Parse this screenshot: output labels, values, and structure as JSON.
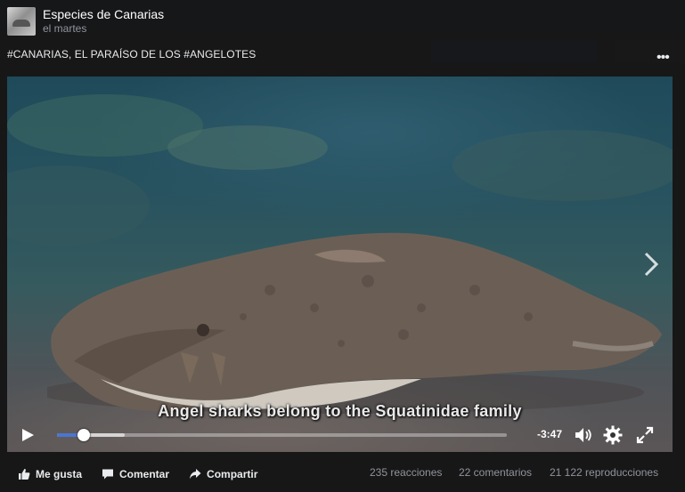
{
  "page": {
    "name": "Especies de Canarias",
    "time": "el martes"
  },
  "post": {
    "text": "#CANARIAS, EL PARAÍSO DE LOS #ANGELOTES"
  },
  "video": {
    "subtitle": "Angel sharks belong to the Squatinidae family",
    "remaining_time": "-3:47",
    "progress_fraction": 0.06,
    "buffered_fraction": 0.15
  },
  "actions": {
    "like": "Me gusta",
    "comment": "Comentar",
    "share": "Compartir"
  },
  "stats": {
    "reactions": "235 reacciones",
    "comments": "22 comentarios",
    "views": "21 122 reproducciones"
  },
  "icons": [
    "more-options-icon",
    "play-icon",
    "volume-icon",
    "settings-icon",
    "fullscreen-icon",
    "next-arrow-icon",
    "like-icon",
    "comment-icon",
    "share-icon"
  ],
  "colors": {
    "progress": "#4a76d1",
    "background": "#1c1c1c",
    "muted_text": "#90949c"
  }
}
